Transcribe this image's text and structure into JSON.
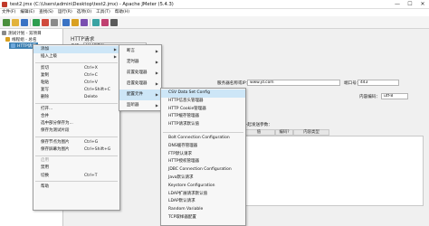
{
  "window": {
    "title": "test2.jmx (C:\\Users\\admin\\Desktop\\test2.jmx) - Apache JMeter (5.4.3)",
    "min": "—",
    "max": "☐",
    "close": "✕"
  },
  "menubar": [
    "文件(F)",
    "编辑(E)",
    "查找(S)",
    "运行(R)",
    "选项(O)",
    "工具(T)",
    "帮助(H)"
  ],
  "tree": {
    "test_plan": "测试计划 - 双项目",
    "thread_group": "线程组 - 总名",
    "sampler": "HTTP请求"
  },
  "main": {
    "title": "HTTP请求",
    "name_label": "名称：",
    "name_value": "HTTP请求",
    "comment_label": "注释：",
    "server_label": "服务器名称或IP：",
    "server_value": "www.jd.com",
    "port_label": "端口号：",
    "port_value": "443",
    "encoding_label": "内容编码：",
    "encoding_value": "utf-8",
    "send_params_label": "同请求一起发送参数：",
    "col_value": "值",
    "col_encode": "编码?",
    "col_contains": "内容类型"
  },
  "context_menu": {
    "items": [
      {
        "label": "添加",
        "shortcut": "",
        "submenu": true,
        "highlight": true
      },
      {
        "label": "插入上级",
        "shortcut": "",
        "submenu": true
      },
      {
        "sep": true
      },
      {
        "label": "剪切",
        "shortcut": "Ctrl+X"
      },
      {
        "label": "复制",
        "shortcut": "Ctrl+C"
      },
      {
        "label": "粘贴",
        "shortcut": "Ctrl+V"
      },
      {
        "label": "复写",
        "shortcut": "Ctrl+Shift+C"
      },
      {
        "label": "删除",
        "shortcut": "Delete"
      },
      {
        "sep": true
      },
      {
        "label": "打开...",
        "shortcut": ""
      },
      {
        "label": "合并",
        "shortcut": ""
      },
      {
        "label": "选中部分保存为...",
        "shortcut": ""
      },
      {
        "label": "保存为测试片段",
        "shortcut": ""
      },
      {
        "sep": true
      },
      {
        "label": "保存节点为图片",
        "shortcut": "Ctrl+G"
      },
      {
        "label": "保存屏幕为图片",
        "shortcut": "Ctrl+Shift+G"
      },
      {
        "sep": true
      },
      {
        "label": "启用",
        "shortcut": "",
        "disabled": true
      },
      {
        "label": "禁用",
        "shortcut": ""
      },
      {
        "label": "切换",
        "shortcut": "Ctrl+T"
      },
      {
        "sep": true
      },
      {
        "label": "帮助",
        "shortcut": ""
      }
    ]
  },
  "add_submenu": {
    "items": [
      {
        "label": "断言",
        "submenu": true
      },
      {
        "label": "定时器",
        "submenu": true
      },
      {
        "label": "前置处理器",
        "submenu": true
      },
      {
        "label": "后置处理器",
        "submenu": true
      },
      {
        "label": "配置元件",
        "submenu": true,
        "highlight": true
      },
      {
        "label": "监听器",
        "submenu": true
      }
    ]
  },
  "config_submenu": {
    "items": [
      {
        "label": "CSV Data Set Config",
        "highlight": true
      },
      {
        "label": "HTTP信息头管理器"
      },
      {
        "label": "HTTP Cookie管理器"
      },
      {
        "label": "HTTP缓存管理器"
      },
      {
        "label": "HTTP请求默认值"
      },
      {
        "sep": true
      },
      {
        "label": "Bolt Connection Configuration"
      },
      {
        "label": "DNS缓存管理器"
      },
      {
        "label": "FTP默认请求"
      },
      {
        "label": "HTTP授权管理器"
      },
      {
        "label": "JDBC Connection Configuration"
      },
      {
        "label": "Java默认请求"
      },
      {
        "label": "Keystore Configuration"
      },
      {
        "label": "LDAP扩展请求默认值"
      },
      {
        "label": "LDAP默认请求"
      },
      {
        "label": "Random Variable"
      },
      {
        "label": "TCP取样器配置"
      }
    ]
  },
  "colors": {
    "highlight": "#cde6f7",
    "selection": "#3c7fb1",
    "toolbar_icons": [
      "#4a8f3c",
      "#e2b23c",
      "#3a73c4",
      "#2e9e4f",
      "#d04a3c",
      "#8a8a8a",
      "#3a73c4",
      "#d9a020",
      "#7a4fb0",
      "#3aa3a3",
      "#c04070",
      "#5a5a5a"
    ]
  }
}
